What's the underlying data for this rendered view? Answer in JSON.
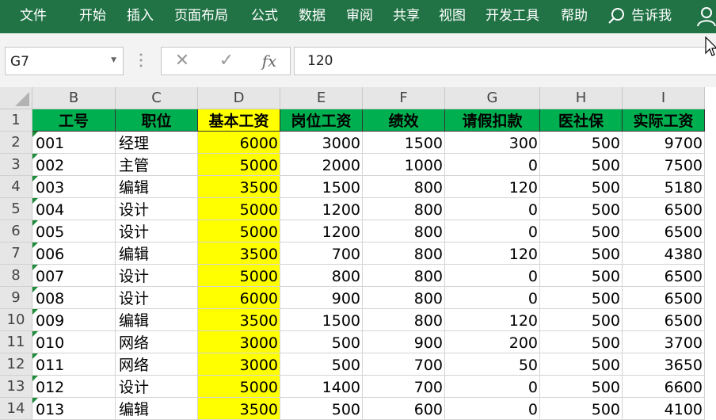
{
  "ribbon": {
    "menu": [
      "文件",
      "开始",
      "插入",
      "页面布局",
      "公式",
      "数据",
      "审阅",
      "共享",
      "视图",
      "开发工具",
      "帮助"
    ],
    "tell_me": "告诉我",
    "icons": [
      "search-icon",
      "user-icon"
    ]
  },
  "formula_bar": {
    "name_box": "G7",
    "cancel_symbol": "✕",
    "enter_symbol": "✓",
    "function_symbol": "fx",
    "value": "120"
  },
  "sheet": {
    "columns": [
      "B",
      "C",
      "D",
      "E",
      "F",
      "G",
      "H",
      "I"
    ],
    "rows": [
      "1",
      "2",
      "3",
      "4",
      "5",
      "6",
      "7",
      "8",
      "9",
      "10",
      "11",
      "12",
      "13",
      "14"
    ],
    "header": [
      "工号",
      "职位",
      "基本工资",
      "岗位工资",
      "绩效",
      "请假扣款",
      "医社保",
      "实际工资"
    ],
    "data": [
      [
        "001",
        "经理",
        "6000",
        "3000",
        "1500",
        "300",
        "500",
        "9700"
      ],
      [
        "002",
        "主管",
        "5000",
        "2000",
        "1000",
        "0",
        "500",
        "7500"
      ],
      [
        "003",
        "编辑",
        "3500",
        "1500",
        "800",
        "120",
        "500",
        "5180"
      ],
      [
        "004",
        "设计",
        "5000",
        "1200",
        "800",
        "0",
        "500",
        "6500"
      ],
      [
        "005",
        "设计",
        "5000",
        "1200",
        "800",
        "0",
        "500",
        "6500"
      ],
      [
        "006",
        "编辑",
        "3500",
        "700",
        "800",
        "120",
        "500",
        "4380"
      ],
      [
        "007",
        "设计",
        "5000",
        "800",
        "800",
        "0",
        "500",
        "6500"
      ],
      [
        "008",
        "设计",
        "6000",
        "900",
        "800",
        "0",
        "500",
        "6500"
      ],
      [
        "009",
        "编辑",
        "3500",
        "1500",
        "800",
        "120",
        "500",
        "6500"
      ],
      [
        "010",
        "网络",
        "3000",
        "500",
        "900",
        "200",
        "500",
        "3700"
      ],
      [
        "011",
        "网络",
        "3000",
        "500",
        "700",
        "50",
        "500",
        "3650"
      ],
      [
        "012",
        "设计",
        "5000",
        "1400",
        "700",
        "0",
        "500",
        "6600"
      ],
      [
        "013",
        "编辑",
        "3500",
        "500",
        "600",
        "0",
        "500",
        "4100"
      ]
    ]
  },
  "colors": {
    "ribbon": "#217346",
    "header_fill": "#00b050",
    "highlight_fill": "#ffff00",
    "error_triangle": "#1e8c3a"
  }
}
